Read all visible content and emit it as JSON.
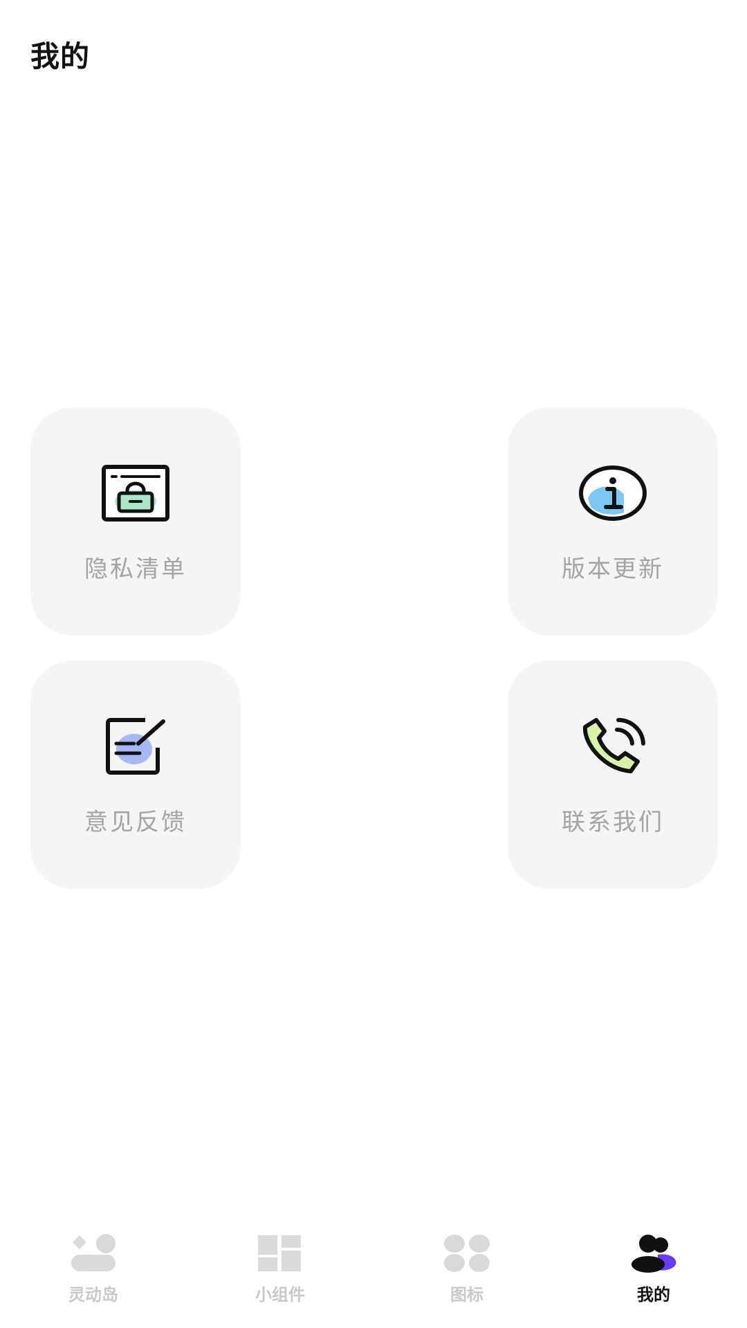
{
  "header": {
    "title": "我的"
  },
  "cards": {
    "privacy": {
      "label": "隐私清单",
      "icon": "lock-document-icon"
    },
    "version": {
      "label": "版本更新",
      "icon": "info-icon"
    },
    "feedback": {
      "label": "意见反馈",
      "icon": "edit-note-icon"
    },
    "contact": {
      "label": "联系我们",
      "icon": "phone-call-icon"
    }
  },
  "tabbar": {
    "items": [
      {
        "label": "灵动岛",
        "icon": "dynamic-island-icon",
        "active": false
      },
      {
        "label": "小组件",
        "icon": "widgets-grid-icon",
        "active": false
      },
      {
        "label": "图标",
        "icon": "icons-dots-icon",
        "active": false
      },
      {
        "label": "我的",
        "icon": "user-profile-icon",
        "active": true
      }
    ]
  },
  "colors": {
    "card_background": "#f5f5f5",
    "label_gray": "#a4a4a4",
    "tab_inactive": "#c8c8c8",
    "tab_active": "#111111",
    "accent_green": "#a9e6c9",
    "accent_blue": "#7cc8f2",
    "accent_periwinkle": "#a7b9f5",
    "accent_lime": "#d7f3a8",
    "accent_purple": "#6a3cf0"
  }
}
